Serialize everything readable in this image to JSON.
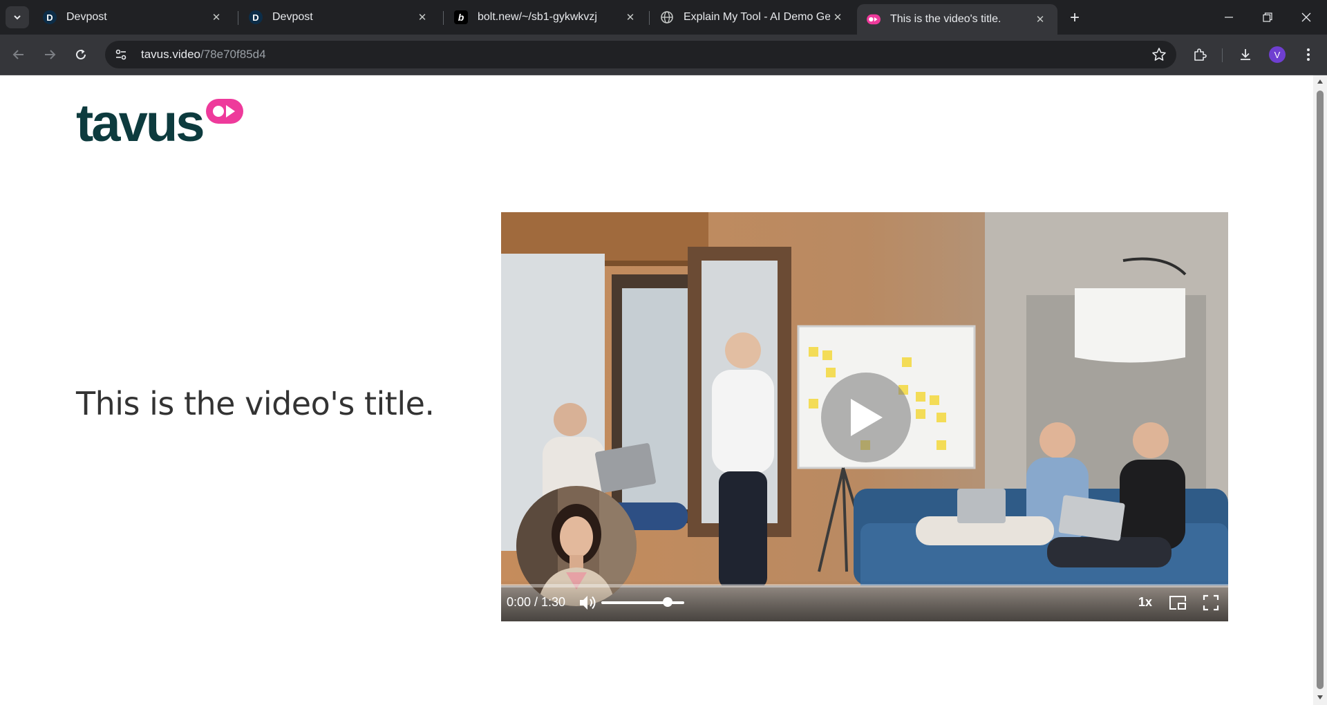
{
  "browser": {
    "tabs": [
      {
        "favicon": "devpost-d-icon",
        "favicon_letter": "D",
        "title": "Devpost",
        "active": false
      },
      {
        "favicon": "devpost-d-icon",
        "favicon_letter": "D",
        "title": "Devpost",
        "active": false
      },
      {
        "favicon": "bolt-b-icon",
        "favicon_letter": "b",
        "title": "bolt.new/~/sb1-gykwkvzj",
        "active": false
      },
      {
        "favicon": "globe-icon",
        "title": "Explain My Tool - AI Demo Gen",
        "active": false
      },
      {
        "favicon": "tavus-icon",
        "title": "This is the video's title.",
        "active": true
      }
    ],
    "address": {
      "domain": "tavus.video",
      "path": "/78e70f85d4"
    },
    "profile_initial": "V",
    "colors": {
      "tabstrip": "#202124",
      "toolbar": "#35363a",
      "avatar": "#6f3fd1"
    }
  },
  "page": {
    "logo_text": "tavus",
    "title": "This is the video's title.",
    "colors": {
      "logo_text": "#0d3b3e",
      "logo_accent": "#ee3a9b",
      "title": "#333333"
    }
  },
  "player": {
    "time": "0:00 / 1:30",
    "progress": 0.0,
    "volume": 0.8,
    "speed": "1x",
    "state": "paused"
  }
}
